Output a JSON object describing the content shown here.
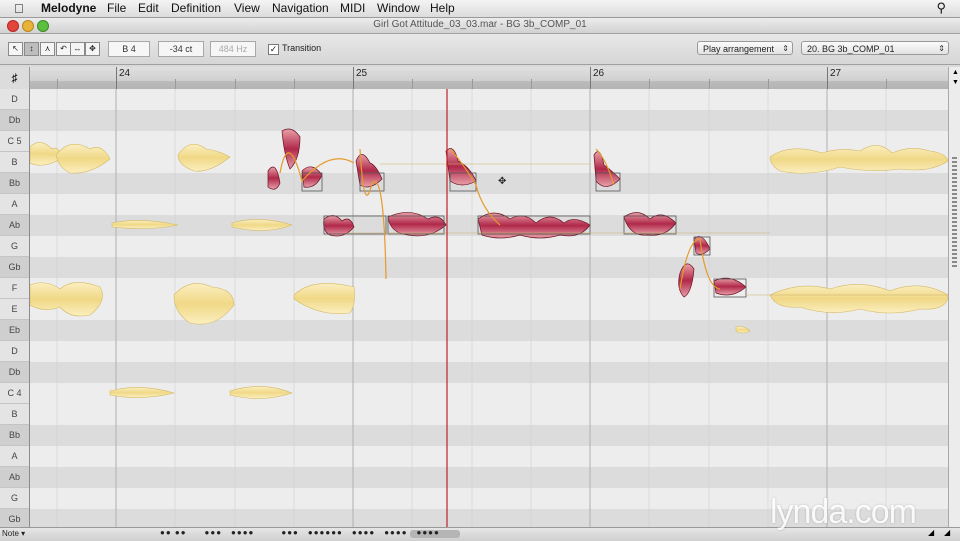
{
  "menubar": {
    "app": "Melodyne",
    "items": [
      "File",
      "Edit",
      "Definition",
      "View",
      "Navigation",
      "MIDI",
      "Window",
      "Help"
    ]
  },
  "window": {
    "title": "Girl Got Attitude_03_03.mar - BG 3b_COMP_01"
  },
  "toolbar": {
    "pitch_field": "B 4",
    "cents_field": "-34 ct",
    "freq_field": "484 Hz",
    "transition_label": "Transition",
    "transition_checked": true,
    "playback_mode": "Play arrangement",
    "track_select": "20. BG 3b_COMP_01"
  },
  "ruler": {
    "bars": [
      "24",
      "25",
      "26",
      "27"
    ]
  },
  "keyboard": {
    "notes": [
      "D",
      "Db",
      "C 5",
      "B",
      "Bb",
      "A",
      "Ab",
      "G",
      "Gb",
      "F",
      "E",
      "Eb",
      "D",
      "Db",
      "C 4",
      "B",
      "Bb",
      "A",
      "Ab",
      "G",
      "Gb"
    ]
  },
  "bottom": {
    "mode_label": "Note"
  },
  "watermark": {
    "text": "lynda.com"
  },
  "colors": {
    "blob_light": "#f4e2a0",
    "blob_selected": "#c83a5a",
    "playhead": "#c0202a"
  }
}
